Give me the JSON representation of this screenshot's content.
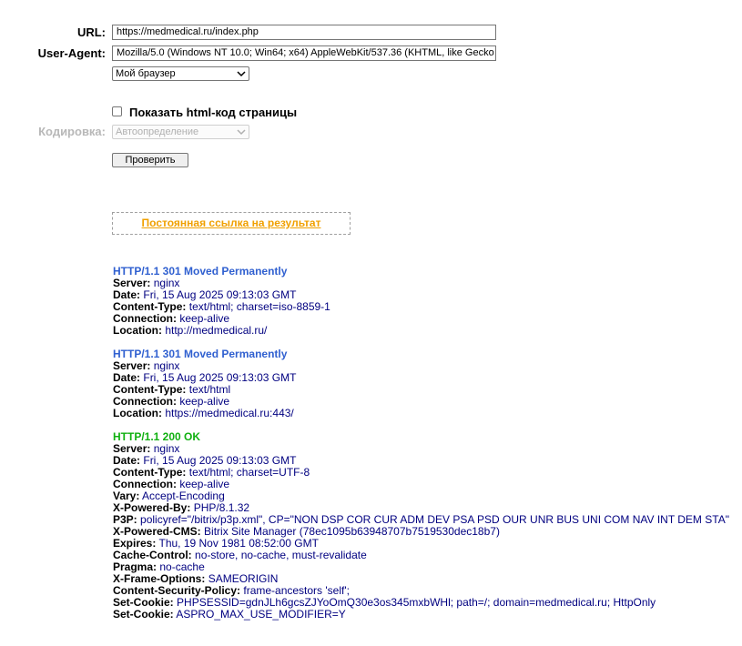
{
  "form": {
    "url_label": "URL:",
    "url_value": "https://medmedical.ru/index.php",
    "ua_label": "User-Agent:",
    "ua_value": "Mozilla/5.0 (Windows NT 10.0; Win64; x64) AppleWebKit/537.36 (KHTML, like Gecko",
    "browser_select": "Мой браузер",
    "show_html_label": "Показать html-код страницы",
    "encoding_label": "Кодировка:",
    "encoding_select": "Автоопределение",
    "check_button": "Проверить",
    "permalink": "Постоянная ссылка на результат"
  },
  "responses": [
    {
      "status": "HTTP/1.1 301 Moved Permanently",
      "kind": "redirect",
      "headers": [
        {
          "name": "Server:",
          "value": "nginx"
        },
        {
          "name": "Date:",
          "value": "Fri, 15 Aug 2025 09:13:03 GMT"
        },
        {
          "name": "Content-Type:",
          "value": "text/html; charset=iso-8859-1"
        },
        {
          "name": "Connection:",
          "value": "keep-alive"
        },
        {
          "name": "Location:",
          "value": "http://medmedical.ru/"
        }
      ]
    },
    {
      "status": "HTTP/1.1 301 Moved Permanently",
      "kind": "redirect",
      "headers": [
        {
          "name": "Server:",
          "value": "nginx"
        },
        {
          "name": "Date:",
          "value": "Fri, 15 Aug 2025 09:13:03 GMT"
        },
        {
          "name": "Content-Type:",
          "value": "text/html"
        },
        {
          "name": "Connection:",
          "value": "keep-alive"
        },
        {
          "name": "Location:",
          "value": "https://medmedical.ru:443/"
        }
      ]
    },
    {
      "status": "HTTP/1.1 200 OK",
      "kind": "ok",
      "headers": [
        {
          "name": "Server:",
          "value": "nginx"
        },
        {
          "name": "Date:",
          "value": "Fri, 15 Aug 2025 09:13:03 GMT"
        },
        {
          "name": "Content-Type:",
          "value": "text/html; charset=UTF-8"
        },
        {
          "name": "Connection:",
          "value": "keep-alive"
        },
        {
          "name": "Vary:",
          "value": "Accept-Encoding"
        },
        {
          "name": "X-Powered-By:",
          "value": "PHP/8.1.32"
        },
        {
          "name": "P3P:",
          "value": "policyref=\"/bitrix/p3p.xml\", CP=\"NON DSP COR CUR ADM DEV PSA PSD OUR UNR BUS UNI COM NAV INT DEM STA\""
        },
        {
          "name": "X-Powered-CMS:",
          "value": "Bitrix Site Manager (78ec1095b63948707b7519530dec18b7)"
        },
        {
          "name": "Expires:",
          "value": "Thu, 19 Nov 1981 08:52:00 GMT"
        },
        {
          "name": "Cache-Control:",
          "value": "no-store, no-cache, must-revalidate"
        },
        {
          "name": "Pragma:",
          "value": "no-cache"
        },
        {
          "name": "X-Frame-Options:",
          "value": "SAMEORIGIN"
        },
        {
          "name": "Content-Security-Policy:",
          "value": "frame-ancestors 'self';"
        },
        {
          "name": "Set-Cookie:",
          "value": "PHPSESSID=gdnJLh6gcsZJYoOmQ30e3os345mxbWHl; path=/; domain=medmedical.ru; HttpOnly"
        },
        {
          "name": "Set-Cookie:",
          "value": "ASPRO_MAX_USE_MODIFIER=Y"
        }
      ]
    }
  ],
  "colors": {
    "redirect_status": "#3060d0",
    "ok_status": "#10b010",
    "header_value": "#000080",
    "permalink": "#f0a000"
  }
}
